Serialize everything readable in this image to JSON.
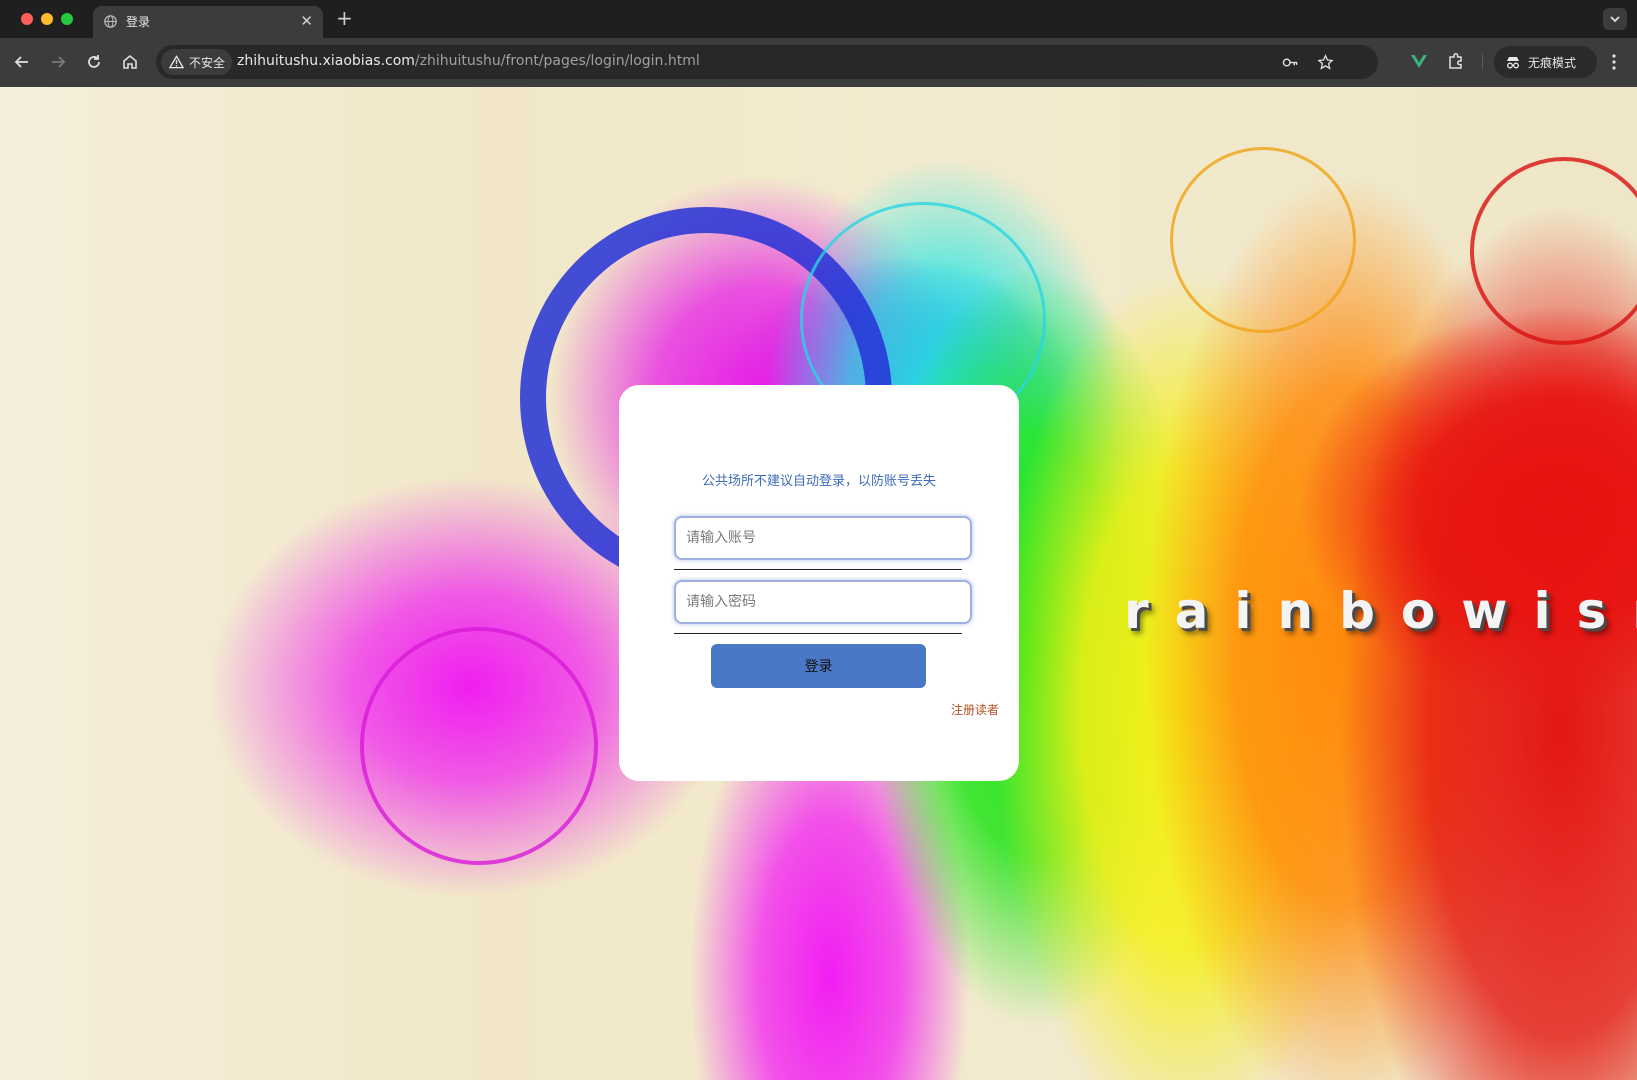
{
  "browser": {
    "tab": {
      "title": "登录",
      "close_glyph": "✕"
    },
    "new_tab_glyph": "+",
    "security_chip": {
      "label": "不安全",
      "icon": "warning-triangle-icon"
    },
    "url": {
      "host": "zhihuitushu.xiaobias.com",
      "path": "/zhihuitushu/front/pages/login/login.html"
    },
    "profile": {
      "label": "无痕模式",
      "icon": "incognito-icon"
    }
  },
  "page": {
    "wordmark": "rainbowism",
    "login": {
      "notice": "公共场所不建议自动登录，以防账号丢失",
      "account_placeholder": "请输入账号",
      "account_value": "",
      "password_placeholder": "请输入密码",
      "password_value": "",
      "submit_label": "登录",
      "register_label": "注册读者"
    }
  },
  "colors": {
    "accent_button": "#4a78c6",
    "notice_text": "#3d6bb8",
    "register_link": "#b4501e",
    "field_border": "#9fb1e0"
  }
}
